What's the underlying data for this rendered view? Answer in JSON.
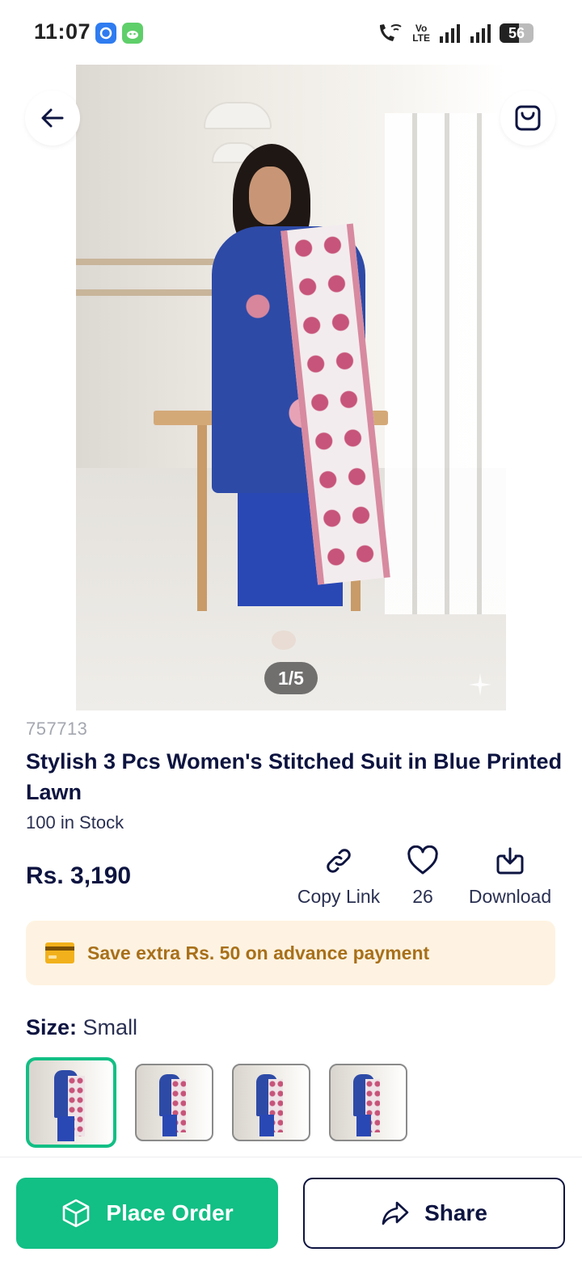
{
  "status_bar": {
    "time": "11:07",
    "volte_top": "Vo",
    "volte_bottom": "LTE",
    "battery": "56",
    "battery_fraction": 0.56
  },
  "product": {
    "image_counter": "1/5",
    "sku": "757713",
    "title": "Stylish 3 Pcs Women's Stitched Suit in Blue Printed Lawn",
    "stock": "100 in Stock",
    "price": "Rs. 3,190"
  },
  "actions": {
    "copy_link_label": "Copy Link",
    "like_count": "26",
    "download_label": "Download"
  },
  "promo": {
    "text": "Save extra Rs. 50 on advance payment"
  },
  "size": {
    "label": "Size:",
    "value": "Small"
  },
  "variants": {
    "count": 4,
    "selected_index": 0
  },
  "bottom_bar": {
    "place_order_label": "Place Order",
    "share_label": "Share"
  },
  "colors": {
    "accent_green": "#12bf85",
    "navy": "#0d1440",
    "promo_bg": "#fef3e2",
    "promo_text": "#a8701a"
  }
}
